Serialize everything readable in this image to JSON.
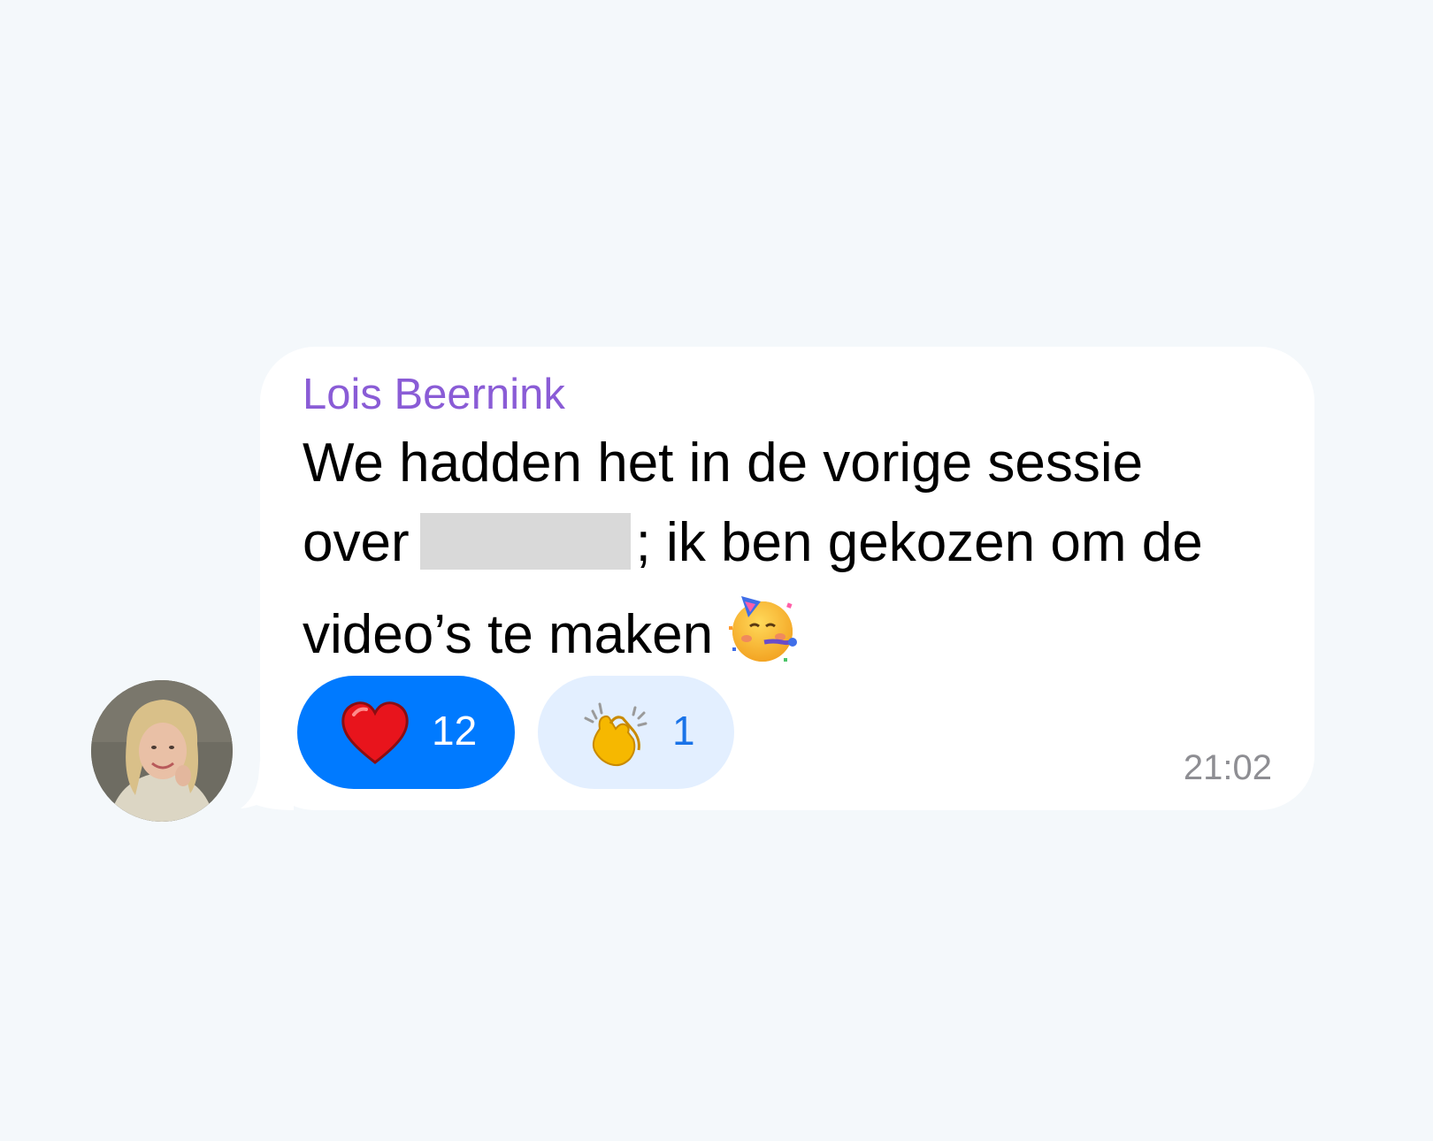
{
  "message": {
    "sender": "Lois Beernink",
    "text_line1": "We hadden het in de vorige sessie",
    "text_line2_before": "over",
    "text_line2_after": "; ik ben gekozen om de",
    "text_line3": "video’s te maken",
    "emoji_icon": "partying-face-icon",
    "timestamp": "21:02"
  },
  "reactions": [
    {
      "icon": "red-heart-icon",
      "count": "12",
      "selected": true
    },
    {
      "icon": "clapping-hands-icon",
      "count": "1",
      "selected": false
    }
  ],
  "colors": {
    "background": "#f4f8fb",
    "bubble": "#ffffff",
    "sender_name": "#8a5cd6",
    "reaction_selected": "#007aff",
    "reaction_unselected": "#e3efff",
    "timestamp": "#8e8e93",
    "redaction": "#d9d9d9"
  }
}
